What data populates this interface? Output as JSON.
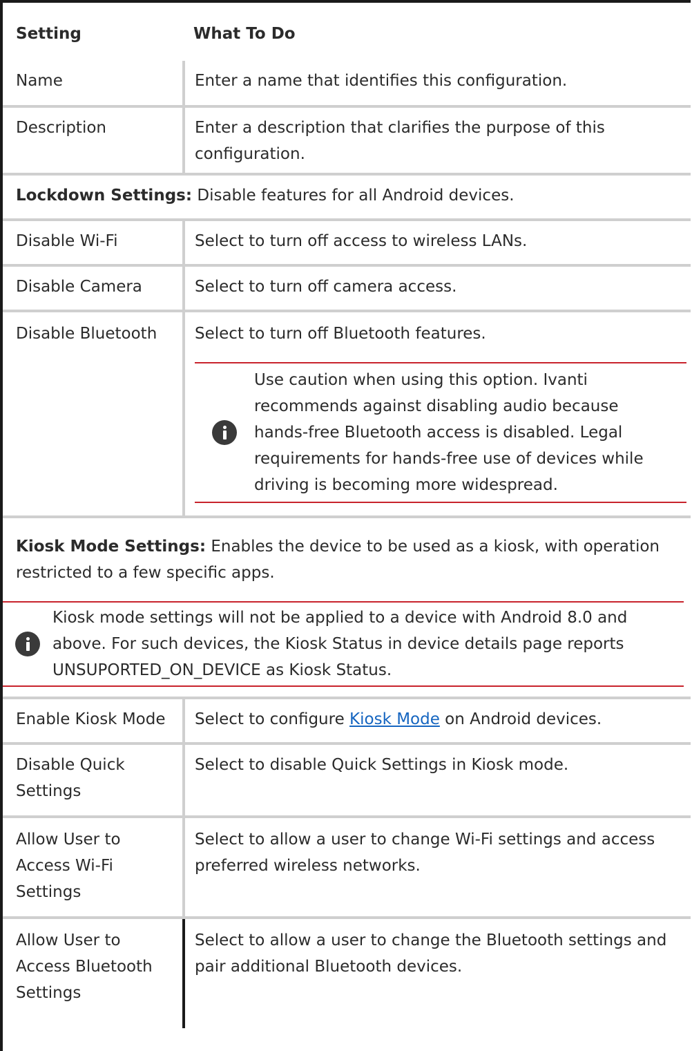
{
  "header": {
    "setting": "Setting",
    "what_to_do": "What To Do"
  },
  "rows_basic": [
    {
      "setting": "Name",
      "desc": "Enter a name that identifies this configuration."
    },
    {
      "setting": "Description",
      "desc": "Enter a description that clarifies the purpose of this configuration."
    }
  ],
  "lockdown": {
    "lead": "Lockdown Settings:",
    "text": " Disable features for all Android devices."
  },
  "lockdown_rows": [
    {
      "setting": "Disable Wi-Fi",
      "desc": "Select to turn off access to wireless LANs."
    },
    {
      "setting": "Disable Camera",
      "desc": "Select to turn off camera access."
    },
    {
      "setting": "Disable Bluetooth",
      "desc": "Select to turn off Bluetooth features.",
      "note": "Use caution when using this option. Ivanti recommends against disabling audio because hands-free Bluetooth access is disabled. Legal requirements for hands-free use of devices while driving is becoming more widespread."
    }
  ],
  "kiosk": {
    "lead": "Kiosk Mode Settings:",
    "text": " Enables the device to be used as a kiosk, with operation restricted to a few specific apps.",
    "note": "Kiosk mode settings will not be applied to a device with Android 8.0 and above. For such devices, the Kiosk Status in device details page reports UNSUPORTED_ON_DEVICE as Kiosk Status."
  },
  "kiosk_rows": [
    {
      "setting": "Enable Kiosk Mode",
      "desc_before": "Select to configure ",
      "link": "Kiosk Mode",
      "desc_after": " on Android devices."
    },
    {
      "setting": "Disable Quick Settings",
      "desc": "Select to disable Quick Settings in Kiosk mode."
    },
    {
      "setting": "Allow User to Access Wi-Fi Settings",
      "desc": "Select to allow a  user to change Wi-Fi settings and access preferred wireless networks."
    },
    {
      "setting": "Allow User to Access Bluetooth Settings",
      "desc": "Select to allow a user to change the Bluetooth settings and pair additional Bluetooth devices."
    }
  ]
}
